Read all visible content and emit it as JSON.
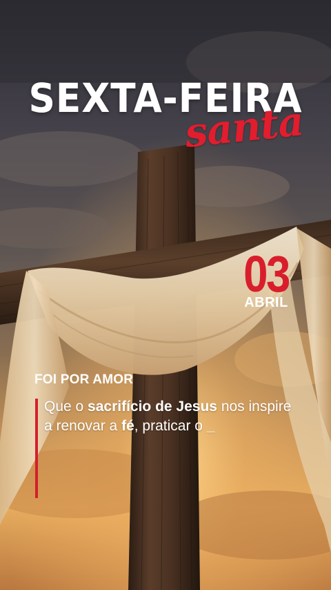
{
  "title": "SEXTA-FEIRA",
  "subtitle_script": "santa",
  "date": {
    "day": "03",
    "month": "ABRIL"
  },
  "heading": "FOI POR AMOR",
  "message": {
    "t1": "Que o ",
    "b1": "sacrifício de Jesus",
    "t2": " nos inspire a renovar a ",
    "b2": "fé",
    "t3": ", praticar o ",
    "cursor": "_"
  },
  "colors": {
    "accent_red": "#d81e2c",
    "text_white": "#ffffff"
  },
  "icons": [
    "cross-icon",
    "cloth-drape-icon"
  ]
}
